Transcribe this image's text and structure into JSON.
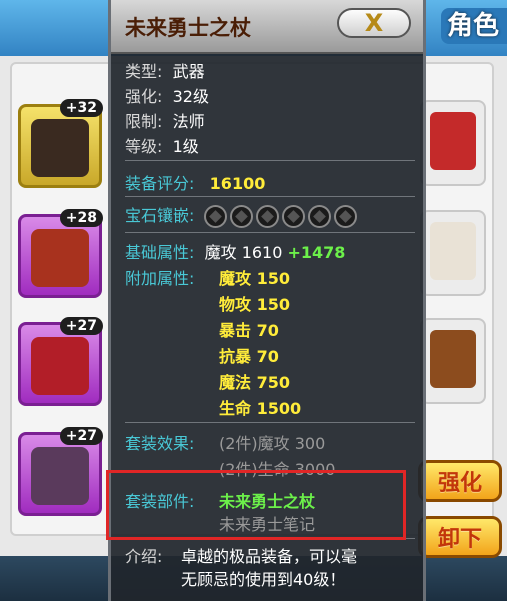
{
  "background": {
    "header_title": "角色",
    "slots_left": [
      {
        "level": "+32",
        "style": "gold"
      },
      {
        "level": "+28",
        "style": "purple"
      },
      {
        "level": "+27",
        "style": "purple"
      },
      {
        "level": "+27",
        "style": "purple"
      }
    ],
    "side_buttons": {
      "strengthen": "强化",
      "unequip": "卸下"
    }
  },
  "tooltip": {
    "title": "未来勇士之杖",
    "close_label": "X",
    "basic": [
      {
        "key": "类型:",
        "value": "武器"
      },
      {
        "key": "强化:",
        "value": "32级"
      },
      {
        "key": "限制:",
        "value": "法师"
      },
      {
        "key": "等级:",
        "value": "1级"
      }
    ],
    "score": {
      "key": "装备评分:",
      "value": "16100"
    },
    "gems": {
      "key": "宝石镶嵌:",
      "count": 6
    },
    "base_attr": {
      "key": "基础属性:",
      "name": "魔攻",
      "value": "1610",
      "bonus": "+1478"
    },
    "extra_attr": {
      "key": "附加属性:",
      "items": [
        "魔攻 150",
        "物攻 150",
        "暴击 70",
        "抗暴 70",
        "魔法 750",
        "生命 1500"
      ]
    },
    "set_effect": {
      "key": "套装效果:",
      "items": [
        "(2件)魔攻 300",
        "(2件)生命 3000"
      ]
    },
    "set_parts": {
      "key": "套装部件:",
      "owned": "未来勇士之杖",
      "missing": "未来勇士笔记"
    },
    "intro": {
      "key": "介绍:",
      "line1": "卓越的极品装备，可以毫",
      "line2": "无顾忌的使用到40级！"
    }
  },
  "colors": {
    "stat_value": "#ffec3a",
    "set_owned": "#6cf04a",
    "set_missing": "#9a9a9a",
    "highlight": "#e02626"
  }
}
